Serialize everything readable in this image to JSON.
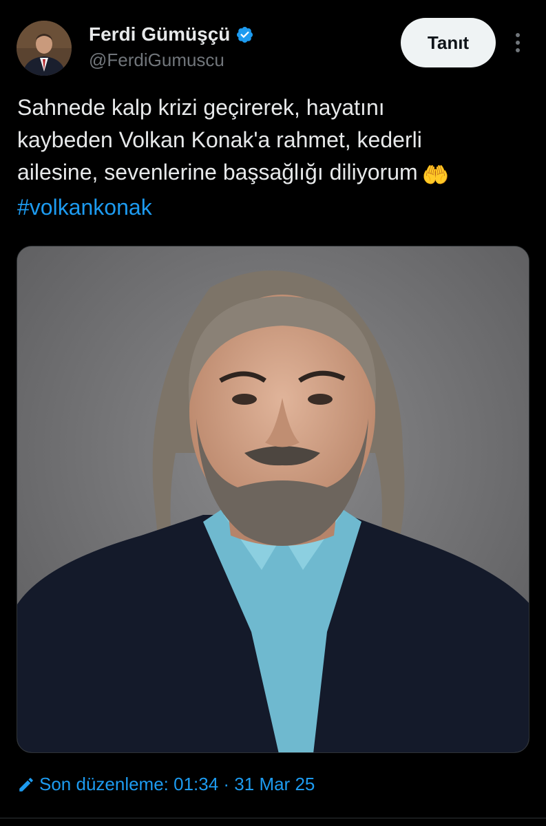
{
  "author": {
    "display_name": "Ferdi Gümüşçü",
    "handle": "@FerdiGumuscu",
    "verified": true,
    "avatar_icon": "avatar"
  },
  "header": {
    "follow_label": "Tanıt",
    "more_icon": "more-vertical-icon"
  },
  "tweet": {
    "lines": [
      "Sahnede kalp krizi geçirerek, hayatını",
      "kaybeden Volkan Konak'a rahmet,  kederli",
      "ailesine, sevenlerine başsağlığı diliyorum"
    ],
    "emoji": "🤲",
    "hashtag": "#volkankonak"
  },
  "media": {
    "type": "photo",
    "icon": "portrait-photo"
  },
  "footer": {
    "edited_label": "Son düzenleme: 01:34 · 31 Mar 25",
    "edit_icon": "pencil-icon"
  },
  "colors": {
    "background": "#000000",
    "text": "#e7e9ea",
    "secondary": "#71767b",
    "link": "#1d9bf0",
    "button_bg": "#eff3f4"
  }
}
